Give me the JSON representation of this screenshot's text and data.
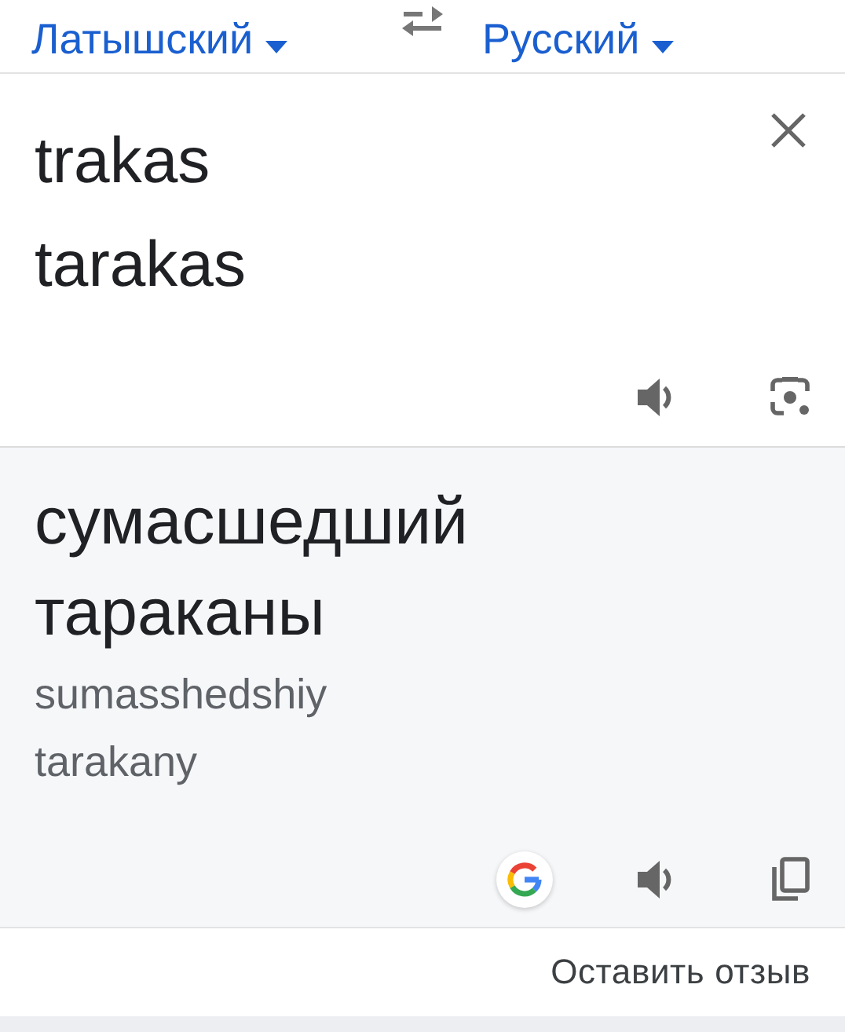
{
  "languages": {
    "source": "Латышский",
    "target": "Русский"
  },
  "source": {
    "lines": [
      "trakas",
      "tarakas"
    ]
  },
  "result": {
    "lines": [
      "сумасшедший",
      "тараканы"
    ],
    "transliteration": [
      "sumasshedshiy",
      "tarakany"
    ]
  },
  "feedback": "Оставить отзыв"
}
